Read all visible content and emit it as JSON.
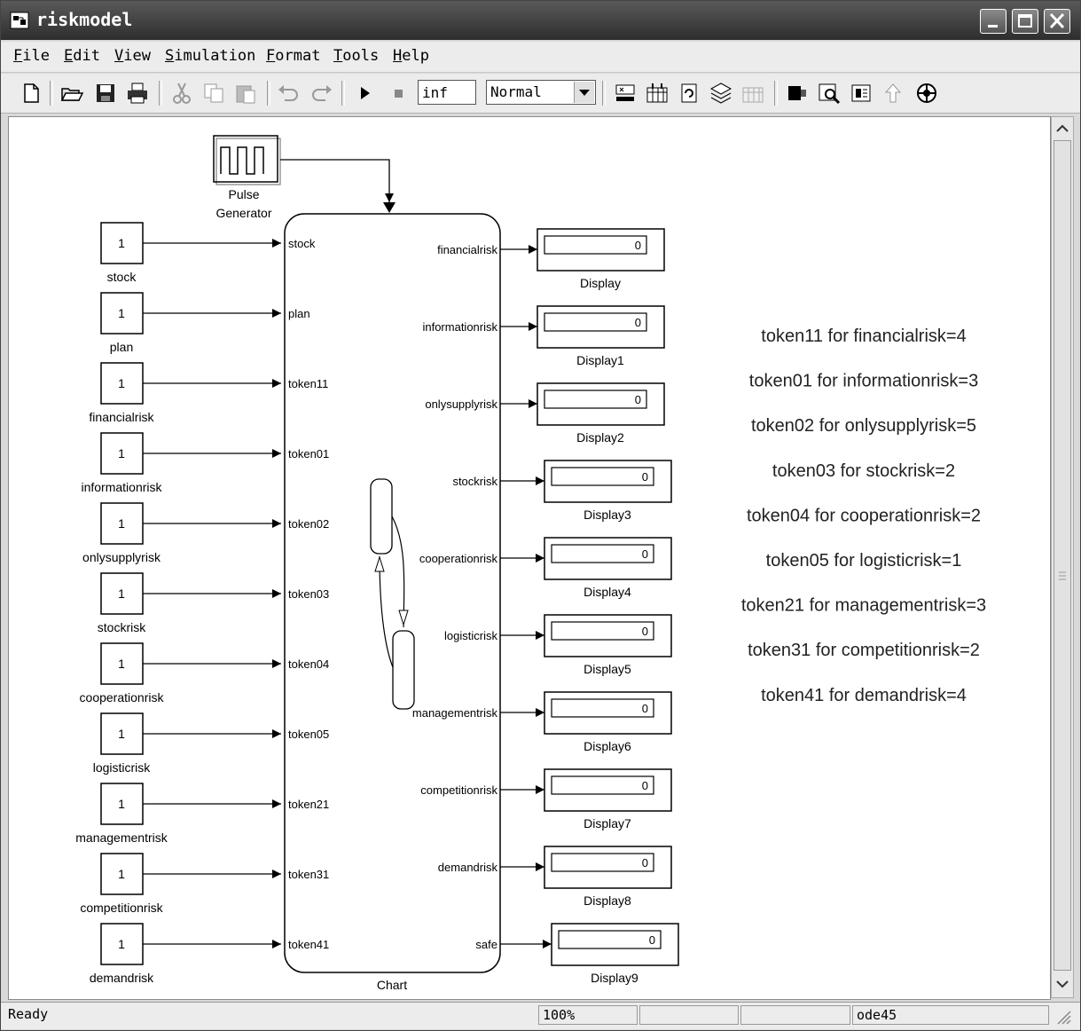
{
  "window": {
    "title": "riskmodel",
    "icons": {
      "app": "simulink-model-icon",
      "minimize": "minimize-icon",
      "maximize": "maximize-icon",
      "close": "close-icon"
    }
  },
  "menu": [
    "File",
    "Edit",
    "View",
    "Simulation",
    "Format",
    "Tools",
    "Help"
  ],
  "toolbar": {
    "icons": [
      "new-file-icon",
      "open-folder-icon",
      "save-icon",
      "print-icon",
      "cut-icon",
      "copy-icon",
      "paste-icon",
      "undo-icon",
      "redo-icon",
      "play-icon",
      "stop-icon",
      "build-icon",
      "library-icon",
      "update-icon",
      "model-explorer-icon",
      "debugger-icon",
      "model-advisor-icon",
      "find-icon",
      "properties-icon",
      "go-to-parent-icon",
      "target-icon"
    ],
    "stop_time": "inf",
    "sim_mode": "Normal"
  },
  "diagram": {
    "pulse": {
      "label_line1": "Pulse",
      "label_line2": "Generator"
    },
    "chart_label": "Chart",
    "inputs": [
      {
        "value": "1",
        "label": "stock",
        "port": "stock"
      },
      {
        "value": "1",
        "label": "plan",
        "port": "plan"
      },
      {
        "value": "1",
        "label": "financialrisk",
        "port": "token11"
      },
      {
        "value": "1",
        "label": "informationrisk",
        "port": "token01"
      },
      {
        "value": "1",
        "label": "onlysupplyrisk",
        "port": "token02"
      },
      {
        "value": "1",
        "label": "stockrisk",
        "port": "token03"
      },
      {
        "value": "1",
        "label": "cooperationrisk",
        "port": "token04"
      },
      {
        "value": "1",
        "label": "logisticrisk",
        "port": "token05"
      },
      {
        "value": "1",
        "label": "managementrisk",
        "port": "token21"
      },
      {
        "value": "1",
        "label": "competitionrisk",
        "port": "token31"
      },
      {
        "value": "1",
        "label": "demandrisk",
        "port": "token41"
      }
    ],
    "outputs": [
      {
        "port": "financialrisk",
        "display": "Display",
        "value": "0"
      },
      {
        "port": "informationrisk",
        "display": "Display1",
        "value": "0"
      },
      {
        "port": "onlysupplyrisk",
        "display": "Display2",
        "value": "0"
      },
      {
        "port": "stockrisk",
        "display": "Display3",
        "value": "0"
      },
      {
        "port": "cooperationrisk",
        "display": "Display4",
        "value": "0"
      },
      {
        "port": "logisticrisk",
        "display": "Display5",
        "value": "0"
      },
      {
        "port": "managementrisk",
        "display": "Display6",
        "value": "0"
      },
      {
        "port": "competitionrisk",
        "display": "Display7",
        "value": "0"
      },
      {
        "port": "demandrisk",
        "display": "Display8",
        "value": "0"
      },
      {
        "port": "safe",
        "display": "Display9",
        "value": "0"
      }
    ],
    "annotations": [
      "token11 for financialrisk=4",
      "token01 for informationrisk=3",
      "token02 for onlysupplyrisk=5",
      "token03 for stockrisk=2",
      "token04 for cooperationrisk=2",
      "token05 for logisticrisk=1",
      "token21 for managementrisk=3",
      "token31 for competitionrisk=2",
      "token41 for demandrisk=4"
    ]
  },
  "status": {
    "text": "Ready",
    "zoom": "100%",
    "cell3": "",
    "cell4": "",
    "solver": "ode45"
  }
}
